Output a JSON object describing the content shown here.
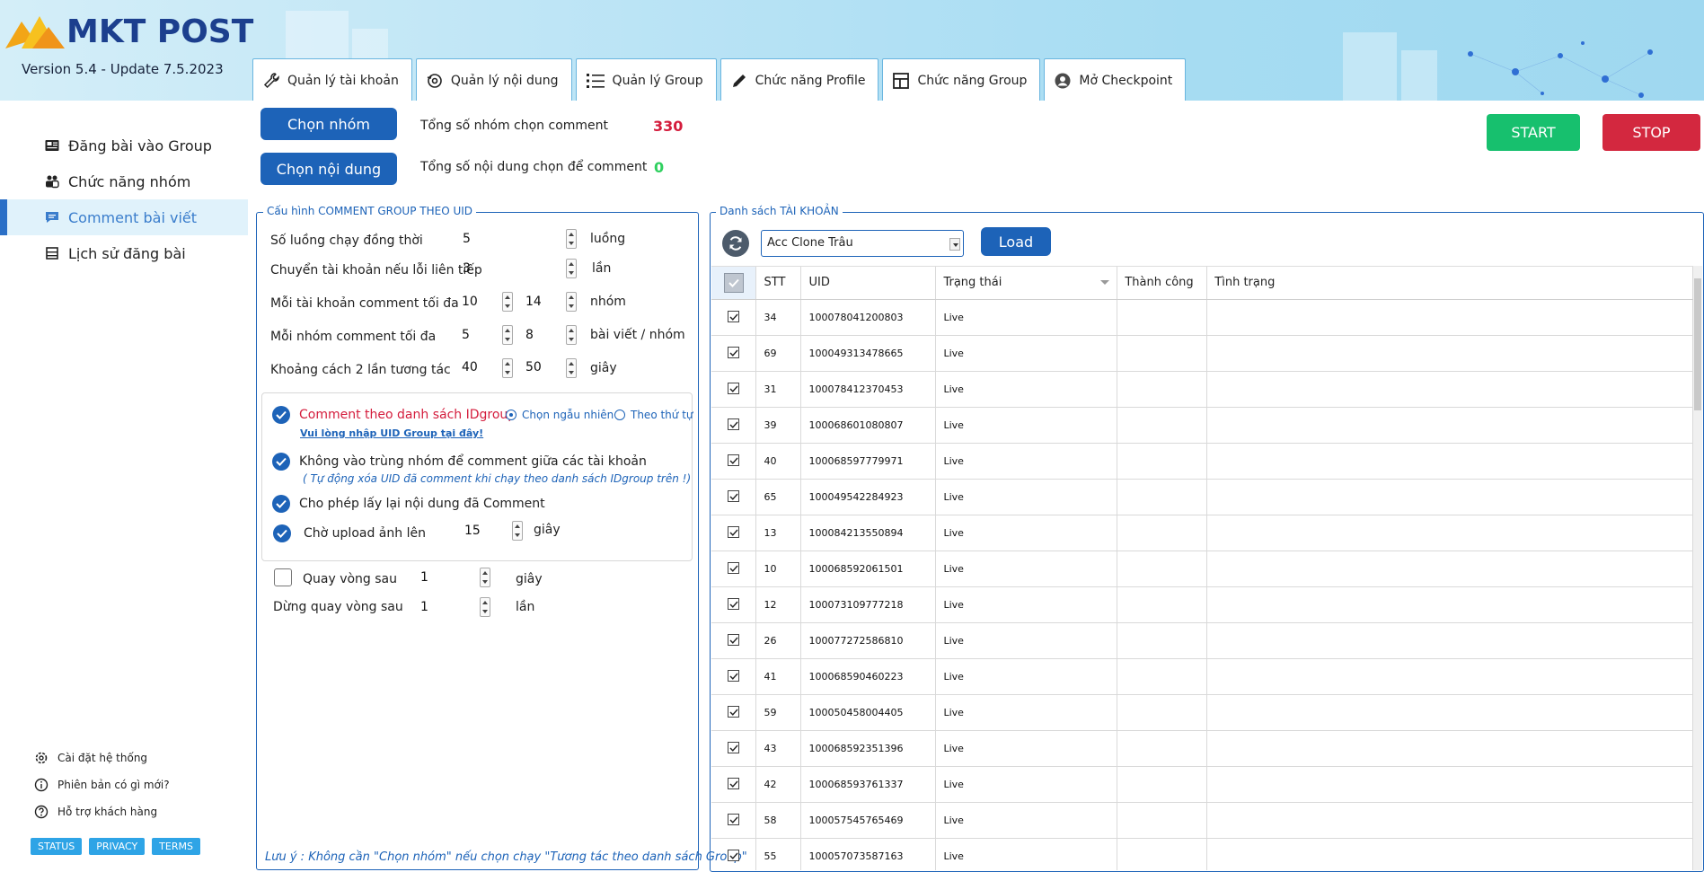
{
  "app": {
    "logo_text": "MKT POST",
    "version": "Version 5.4 - Update 7.5.2023"
  },
  "tabs": [
    {
      "label": "Quản lý tài khoản",
      "icon": "wrench-icon"
    },
    {
      "label": "Quản lý nội dung",
      "icon": "gear-refresh-icon"
    },
    {
      "label": "Quản lý Group",
      "icon": "list-icon"
    },
    {
      "label": "Chức năng Profile",
      "icon": "pencil-icon"
    },
    {
      "label": "Chức năng Group",
      "icon": "grid-icon"
    },
    {
      "label": "Mở Checkpoint",
      "icon": "user-circle-icon"
    }
  ],
  "sidebar": {
    "items": [
      {
        "label": "Đăng bài vào Group",
        "icon": "post-icon"
      },
      {
        "label": "Chức năng nhóm",
        "icon": "group-icon"
      },
      {
        "label": "Comment bài viết",
        "icon": "comment-icon",
        "active": true
      },
      {
        "label": "Lịch sử đăng bài",
        "icon": "history-icon"
      }
    ],
    "bottom": [
      {
        "label": "Cài đặt hệ thống",
        "icon": "gear-icon"
      },
      {
        "label": "Phiên bản có gì mới?",
        "icon": "info-icon"
      },
      {
        "label": "Hỗ trợ khách hàng",
        "icon": "help-icon"
      }
    ],
    "badges": [
      "STATUS",
      "PRIVACY",
      "TERMS"
    ]
  },
  "controls": {
    "choose_group": "Chọn nhóm",
    "choose_content": "Chọn nội dung",
    "total_groups_label": "Tổng số nhóm chọn comment",
    "total_groups_value": "330",
    "total_content_label": "Tổng số nội dung chọn để comment",
    "total_content_value": "0",
    "start": "START",
    "stop": "STOP"
  },
  "config": {
    "title": "Cấu hình COMMENT GROUP THEO UID",
    "threads_label": "Số luồng chạy đồng thời",
    "threads_value": "5",
    "threads_unit": "luồng",
    "switch_label": "Chuyển tài khoản nếu lỗi liên tiếp",
    "switch_value": "3",
    "switch_unit": "lần",
    "per_account_label": "Mỗi tài khoản comment tối đa",
    "per_account_min": "10",
    "per_account_max": "14",
    "per_account_unit": "nhóm",
    "per_group_label": "Mỗi nhóm comment tối đa",
    "per_group_min": "5",
    "per_group_max": "8",
    "per_group_unit": "bài viết / nhóm",
    "interval_label": "Khoảng cách 2 lần tương tác",
    "interval_min": "40",
    "interval_max": "50",
    "interval_unit": "giây",
    "by_list_label": "Comment theo danh sách IDgroup",
    "random_label": "Chọn ngẫu nhiên",
    "order_label": "Theo thứ tự",
    "enter_uid_link": "Vui lòng nhập UID Group tại đây!",
    "no_dup_label": "Không vào trùng nhóm để comment giữa các tài khoản",
    "no_dup_note": "( Tự động xóa UID đã comment khi chạy theo danh sách IDgroup trên !)",
    "reuse_label": "Cho phép lấy lại nội dung đã Comment",
    "wait_upload_label": "Chờ upload ảnh lên",
    "wait_upload_value": "15",
    "wait_upload_unit": "giây",
    "loop_label": "Quay vòng sau",
    "loop_value": "1",
    "loop_unit": "giây",
    "stop_loop_label": "Dừng quay vòng sau",
    "stop_loop_value": "1",
    "stop_loop_unit": "lần",
    "footer_note": "Lưu ý : Không cần \"Chọn nhóm\" nếu chọn chạy \"Tương tác theo danh sách Group\""
  },
  "accounts": {
    "title": "Danh sách TÀI KHOẢN",
    "selected_list": "Acc Clone Trâu",
    "load": "Load",
    "columns": [
      "STT",
      "UID",
      "Trạng thái",
      "Thành công",
      "Tình trạng"
    ],
    "rows": [
      {
        "stt": "34",
        "uid": "100078041200803",
        "status": "Live"
      },
      {
        "stt": "69",
        "uid": "100049313478665",
        "status": "Live"
      },
      {
        "stt": "31",
        "uid": "100078412370453",
        "status": "Live"
      },
      {
        "stt": "39",
        "uid": "100068601080807",
        "status": "Live"
      },
      {
        "stt": "40",
        "uid": "100068597779971",
        "status": "Live"
      },
      {
        "stt": "65",
        "uid": "100049542284923",
        "status": "Live"
      },
      {
        "stt": "13",
        "uid": "100084213550894",
        "status": "Live"
      },
      {
        "stt": "10",
        "uid": "100068592061501",
        "status": "Live"
      },
      {
        "stt": "12",
        "uid": "100073109777218",
        "status": "Live"
      },
      {
        "stt": "26",
        "uid": "100077272586810",
        "status": "Live"
      },
      {
        "stt": "41",
        "uid": "100068590460223",
        "status": "Live"
      },
      {
        "stt": "59",
        "uid": "100050458004405",
        "status": "Live"
      },
      {
        "stt": "43",
        "uid": "100068592351396",
        "status": "Live"
      },
      {
        "stt": "42",
        "uid": "100068593761337",
        "status": "Live"
      },
      {
        "stt": "58",
        "uid": "100057545765469",
        "status": "Live"
      },
      {
        "stt": "55",
        "uid": "100057073587163",
        "status": "Live"
      }
    ]
  },
  "colors": {
    "primary": "#1d63b8",
    "start": "#17c06e",
    "stop": "#d3283f",
    "count_red": "#d41c3c",
    "count_green": "#2fd05f"
  }
}
